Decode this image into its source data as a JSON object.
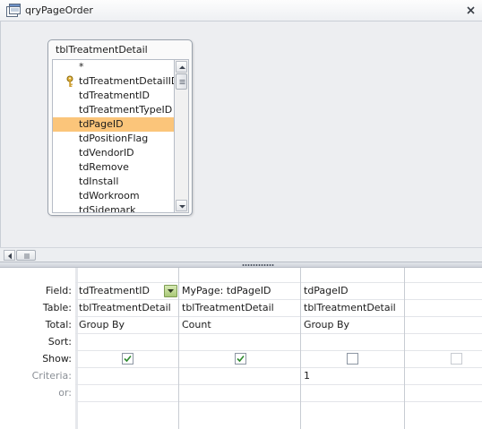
{
  "window": {
    "title": "qryPageOrder"
  },
  "table_window": {
    "title": "tblTreatmentDetail",
    "fields": [
      "*",
      "tdTreatmentDetailID",
      "tdTreatmentID",
      "tdTreatmentTypeID",
      "tdPageID",
      "tdPositionFlag",
      "tdVendorID",
      "tdRemove",
      "tdInstall",
      "tdWorkroom",
      "tdSidemark"
    ],
    "selected_field": "tdPageID",
    "primary_key_field": "tdTreatmentDetailID"
  },
  "grid": {
    "row_labels": {
      "field": "Field:",
      "table": "Table:",
      "total": "Total:",
      "sort": "Sort:",
      "show": "Show:",
      "criteria": "Criteria:",
      "or": "or:"
    },
    "columns": [
      {
        "field": "tdTreatmentID",
        "table": "tblTreatmentDetail",
        "total": "Group By",
        "sort": "",
        "show": true,
        "criteria": ""
      },
      {
        "field": "MyPage: tdPageID",
        "table": "tblTreatmentDetail",
        "total": "Count",
        "sort": "",
        "show": true,
        "criteria": ""
      },
      {
        "field": "tdPageID",
        "table": "tblTreatmentDetail",
        "total": "Group By",
        "sort": "",
        "show": false,
        "criteria": "1"
      },
      {
        "field": "",
        "table": "",
        "total": "",
        "sort": "",
        "show": false,
        "criteria": ""
      }
    ]
  },
  "colors": {
    "selected_field_bg": "#fbc57a",
    "checkmark": "#2e8b2e",
    "pane_bg": "#edeef1"
  },
  "icons": {
    "title": "query-icon",
    "close": "close-icon",
    "key": "key-icon",
    "field_dropdown": "chevron-down-icon"
  }
}
